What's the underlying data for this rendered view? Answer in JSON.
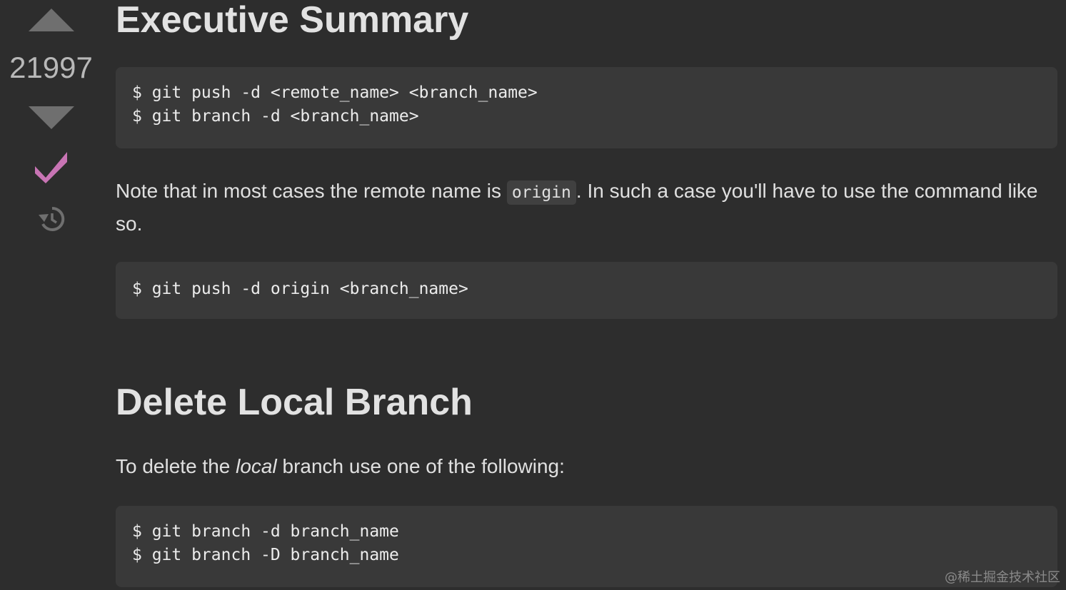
{
  "vote": {
    "score": "21997",
    "accepted_color": "#c874b4"
  },
  "icons": {
    "upvote": "caret-up-icon",
    "downvote": "caret-down-icon",
    "accepted": "checkmark-icon",
    "history": "history-icon"
  },
  "answer": {
    "heading1": "Executive Summary",
    "code1": [
      "$ git push -d <remote_name> <branch_name>",
      "$ git branch -d <branch_name>"
    ],
    "para1_before": "Note that in most cases the remote name is ",
    "para1_code": "origin",
    "para1_after": ". In such a case you'll have to use the command like so.",
    "code2": [
      "$ git push -d origin <branch_name>"
    ],
    "heading2": "Delete Local Branch",
    "para2_before": "To delete the ",
    "para2_em": "local",
    "para2_after": " branch use one of the following:",
    "code3": [
      "$ git branch -d branch_name",
      "$ git branch -D branch_name"
    ]
  },
  "watermark": "@稀土掘金技术社区"
}
